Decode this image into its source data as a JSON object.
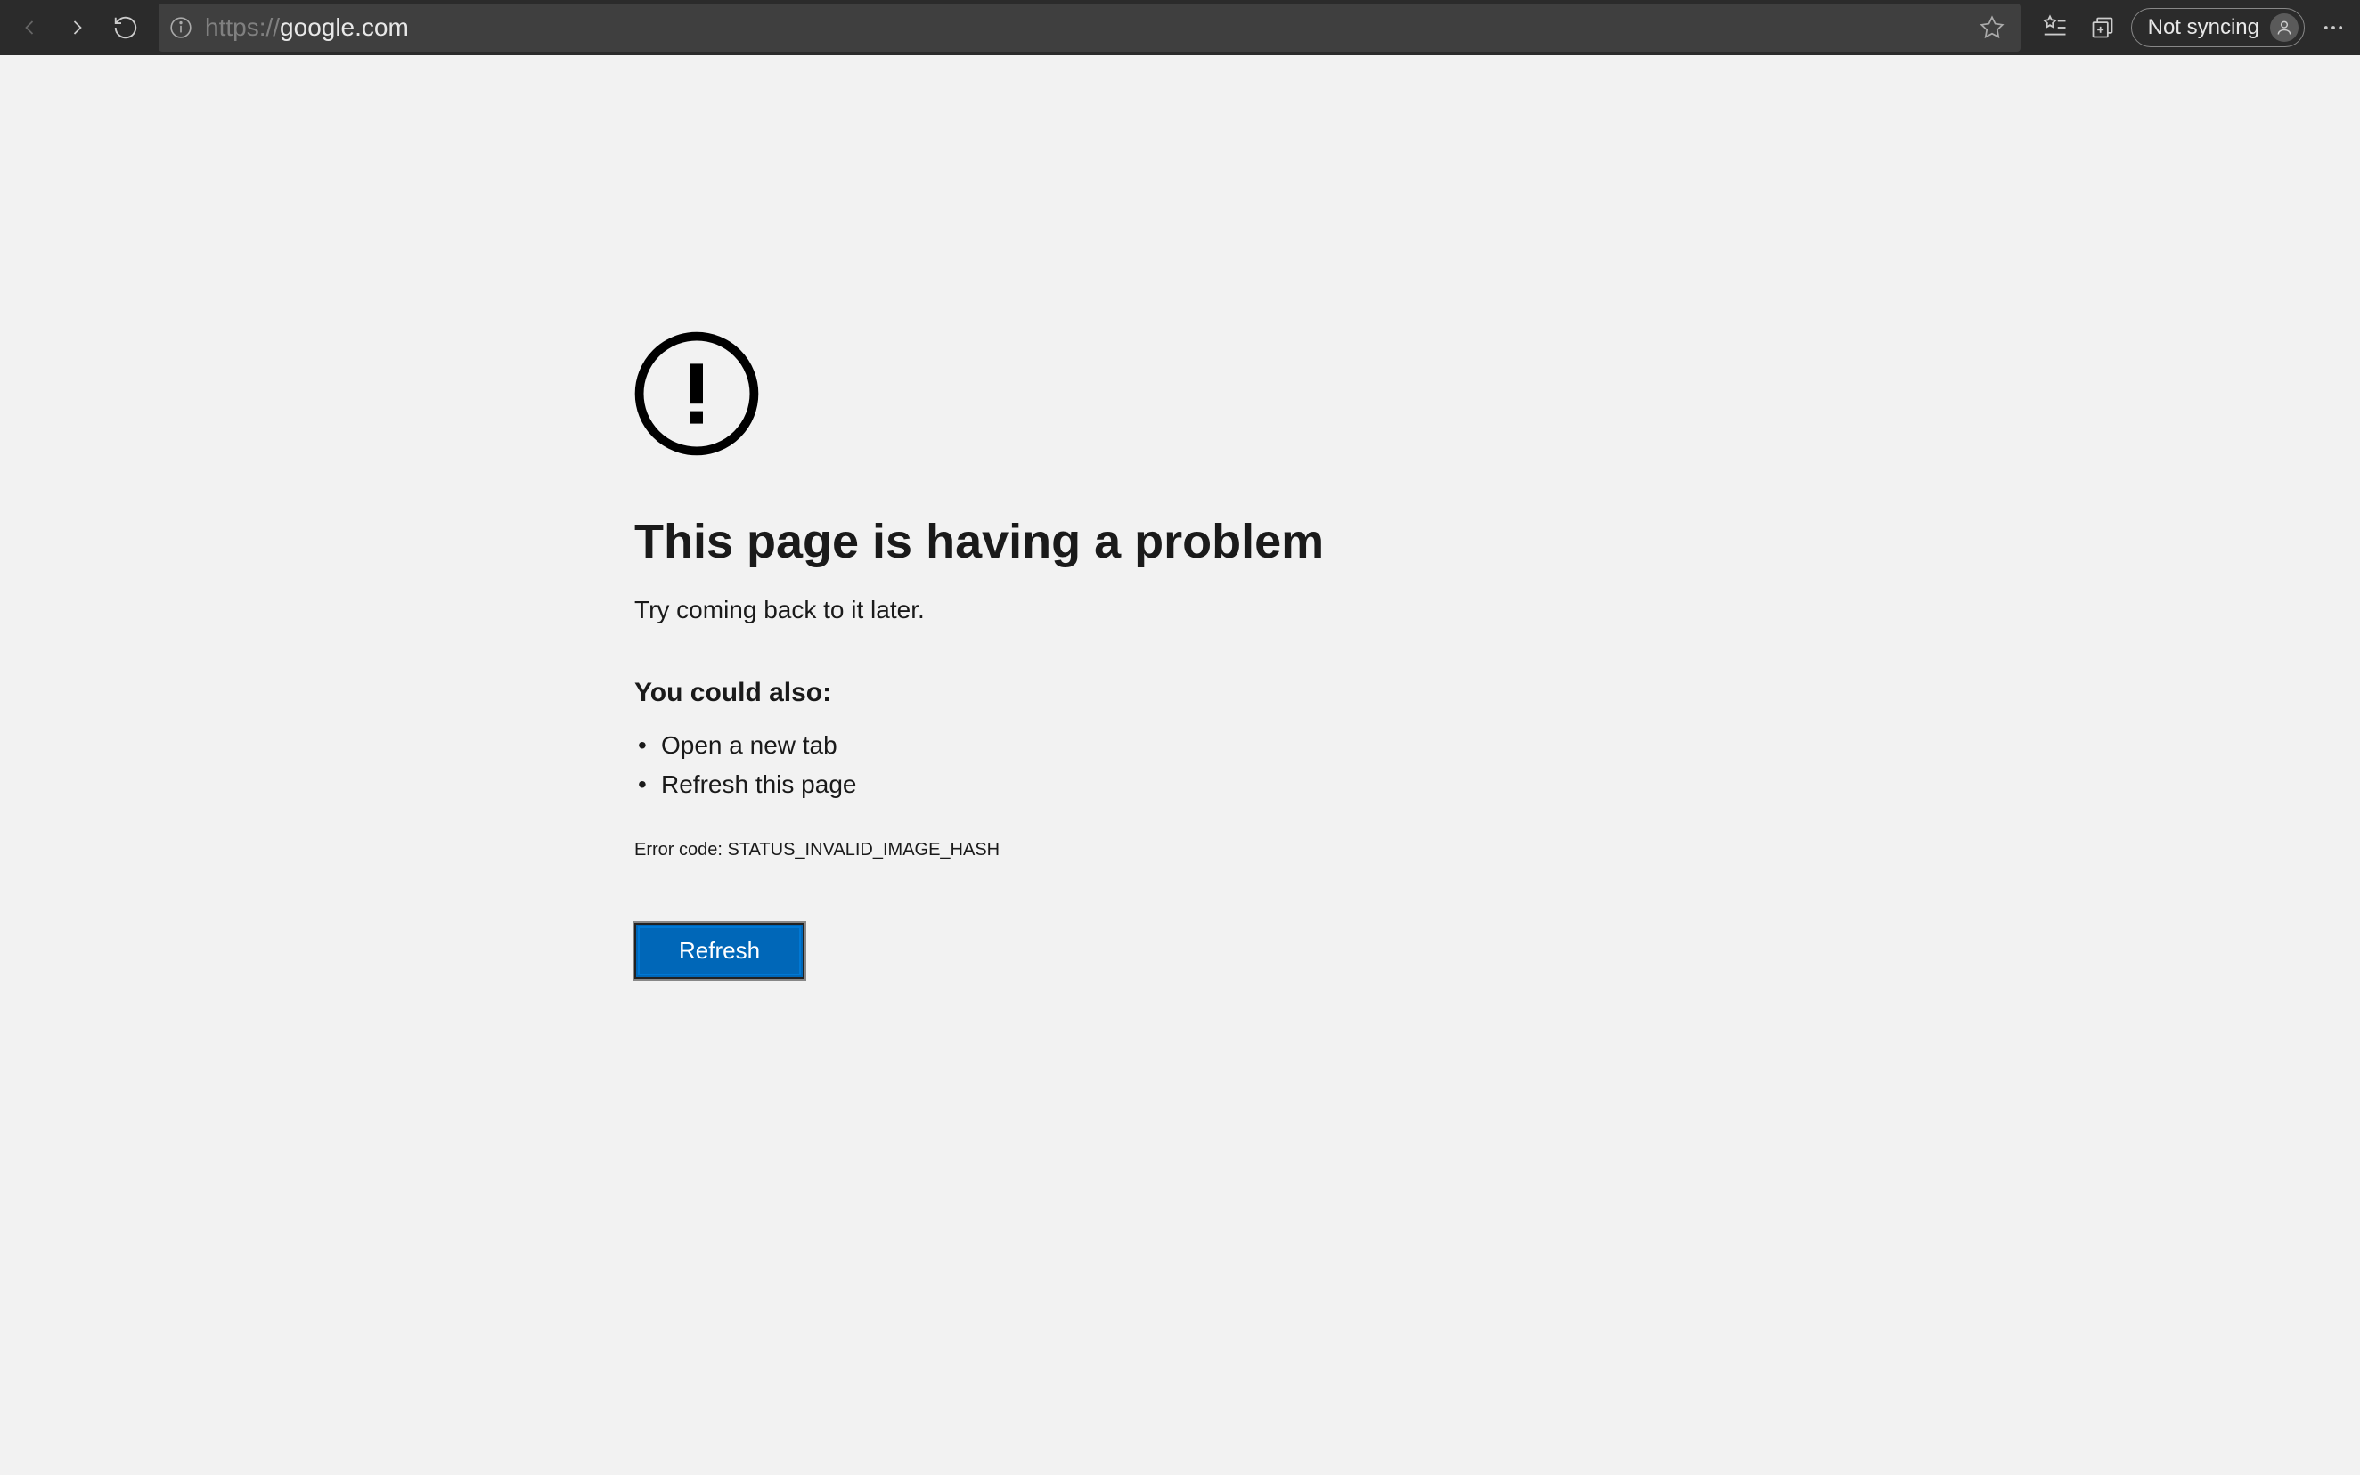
{
  "toolbar": {
    "url_protocol": "https://",
    "url_domain": "google.com",
    "sync_label": "Not syncing"
  },
  "error": {
    "title": "This page is having a problem",
    "subtitle": "Try coming back to it later.",
    "suggestions_heading": "You could also:",
    "suggestions": [
      "Open a new tab",
      "Refresh this page"
    ],
    "error_code_label": "Error code: ",
    "error_code_value": "STATUS_INVALID_IMAGE_HASH",
    "refresh_button": "Refresh"
  }
}
